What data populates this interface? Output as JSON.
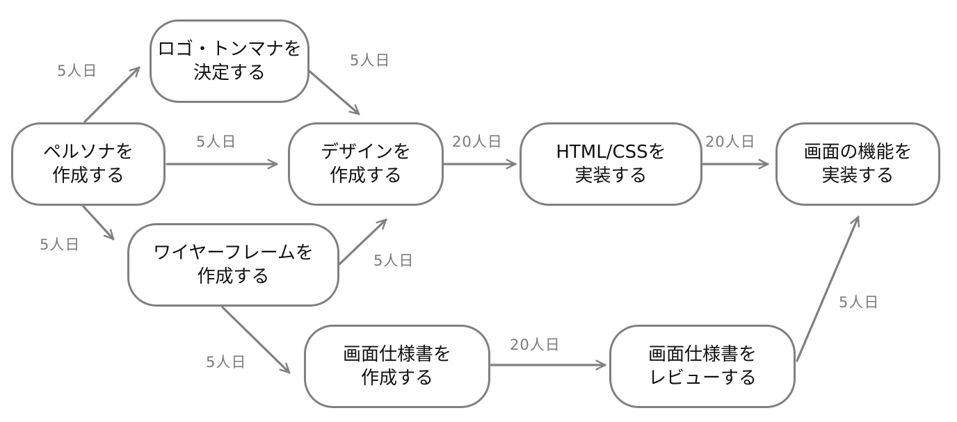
{
  "diagram": {
    "nodes": {
      "persona": {
        "line1": "ペルソナを",
        "line2": "作成する"
      },
      "logo": {
        "line1": "ロゴ・トンマナを",
        "line2": "決定する"
      },
      "wireframe": {
        "line1": "ワイヤーフレームを",
        "line2": "作成する"
      },
      "design": {
        "line1": "デザインを",
        "line2": "作成する"
      },
      "htmlcss": {
        "line1": "HTML/CSSを",
        "line2": "実装する"
      },
      "features": {
        "line1": "画面の機能を",
        "line2": "実装する"
      },
      "spec": {
        "line1": "画面仕様書を",
        "line2": "作成する"
      },
      "review": {
        "line1": "画面仕様書を",
        "line2": "レビューする"
      }
    },
    "edges": [
      {
        "from": "persona",
        "to": "logo",
        "label": "5人日"
      },
      {
        "from": "persona",
        "to": "design",
        "label": "5人日"
      },
      {
        "from": "persona",
        "to": "wireframe",
        "label": "5人日"
      },
      {
        "from": "logo",
        "to": "design",
        "label": "5人日"
      },
      {
        "from": "wireframe",
        "to": "design",
        "label": "5人日"
      },
      {
        "from": "wireframe",
        "to": "spec",
        "label": "5人日"
      },
      {
        "from": "design",
        "to": "htmlcss",
        "label": "20人日"
      },
      {
        "from": "htmlcss",
        "to": "features",
        "label": "20人日"
      },
      {
        "from": "spec",
        "to": "review",
        "label": "20人日"
      },
      {
        "from": "review",
        "to": "features",
        "label": "5人日"
      }
    ],
    "colors": {
      "stroke": "#808080",
      "text": "#111111",
      "label": "#7a7a7a"
    }
  }
}
